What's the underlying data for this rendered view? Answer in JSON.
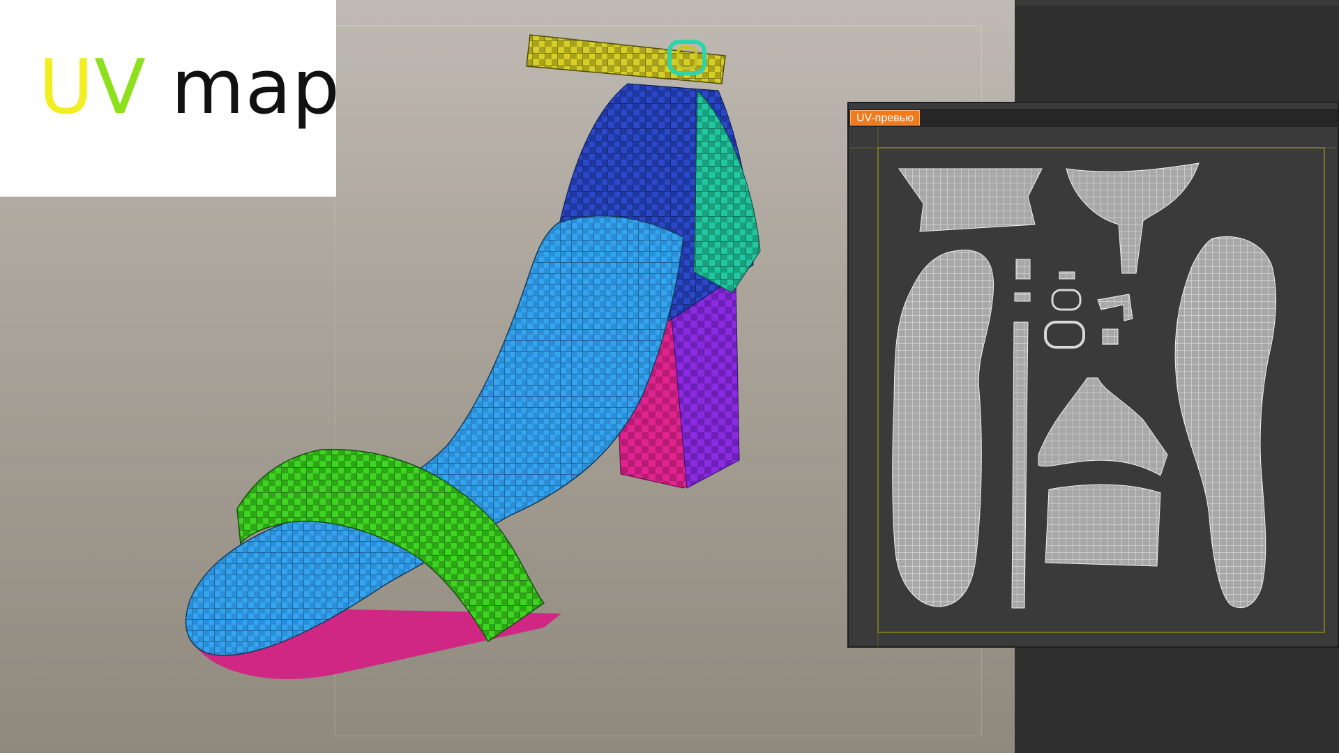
{
  "title_card": {
    "letter_u": "U",
    "letter_v": "V",
    "word": " map"
  },
  "uv_preview_window": {
    "tab_label": "UV-превью"
  },
  "colors": {
    "u_letter": "#f2ee22",
    "v_letter": "#8ee01d",
    "insole": "#35a4ef",
    "strap_front": "#3fd323",
    "ankle_strap": "#c9c324",
    "heel_block": "#e0248f",
    "heel_side": "#8a2be0",
    "heel_counter_inner": "#2740c4",
    "heel_counter_outer": "#22c7a0",
    "uv_tab": "#f07a1e"
  }
}
